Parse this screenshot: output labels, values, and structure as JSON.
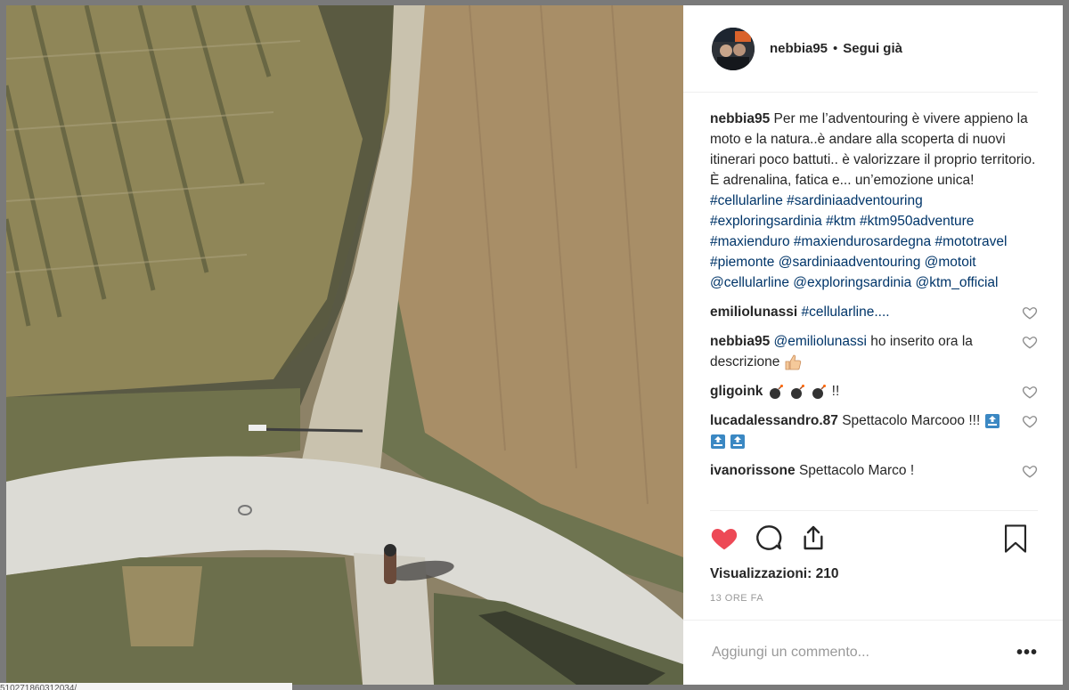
{
  "post": {
    "username": "nebbia95",
    "separator": "•",
    "follow_state": "Segui già"
  },
  "caption": {
    "user": "nebbia95",
    "text": "Per me l’adventouring è vivere appieno la moto e la natura..è andare alla scoperta di nuovi itinerari poco battuti.. è valorizzare il proprio territorio. È adrenalina, fatica e... un’emozione unica! ",
    "tags": [
      "#cellularline",
      "#sardiniaadventouring",
      "#exploringsardinia",
      "#ktm",
      "#ktm950adventure",
      "#maxienduro",
      "#maxiendurosardegna",
      "#mototravel",
      "#piemonte",
      "@sardiniaadventouring",
      "@motoit",
      "@cellularline",
      "@exploringsardinia",
      "@ktm_official"
    ]
  },
  "comments": [
    {
      "user": "emiliolunassi",
      "mention": "#cellularline....",
      "text": ""
    },
    {
      "user": "nebbia95",
      "mention": "@emiliolunassi",
      "text": "ho inserito ora la descrizione"
    },
    {
      "user": "gligoink",
      "mention": "",
      "text": "!!"
    },
    {
      "user": "lucadalessandro.87",
      "mention": "",
      "text": "Spettacolo Marcooo !!!"
    },
    {
      "user": "ivanorissone",
      "mention": "",
      "text": "Spettacolo Marco !"
    }
  ],
  "stats": {
    "views_label": "Visualizzazioni:",
    "views_count": "210",
    "time_ago": "13 ORE FA"
  },
  "add_comment": {
    "placeholder": "Aggiungi un commento...",
    "more": "•••"
  },
  "footer": {
    "partial_text": "510271860312034/"
  },
  "colors": {
    "like_red": "#ed4956",
    "link_blue": "#003569"
  },
  "icons": [
    "heart-icon",
    "comment-icon",
    "share-icon",
    "bookmark-icon",
    "small-heart-icon",
    "bomb-icon",
    "thumbs-up-icon",
    "top-icon"
  ]
}
